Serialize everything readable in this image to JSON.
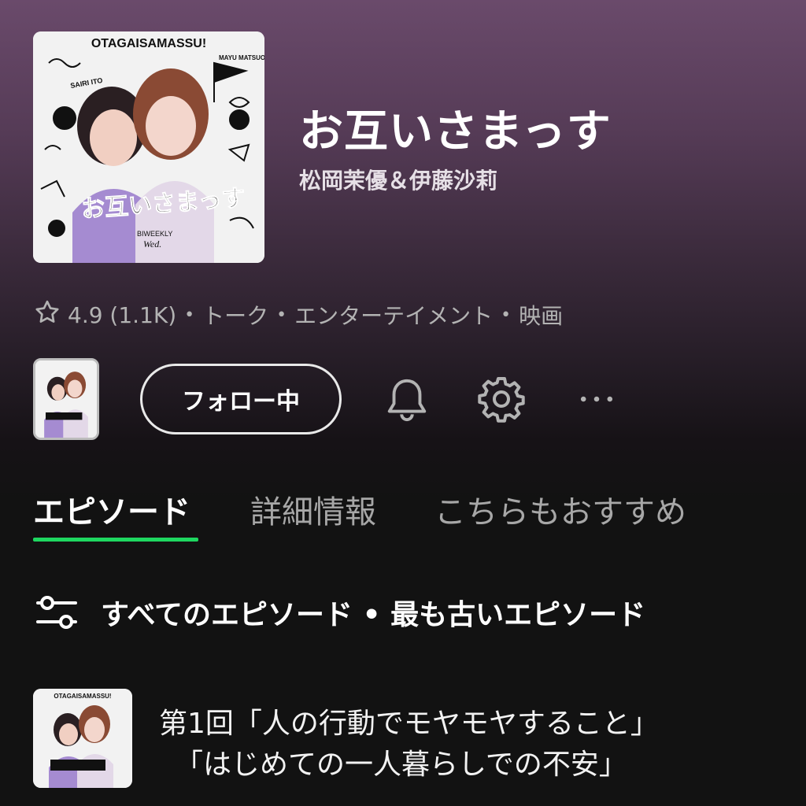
{
  "podcast": {
    "cover_text_top": "OTAGAISAMASSU!",
    "cover_text_name1": "SAIRI ITO",
    "cover_text_name2": "MAYU MATSUOKA",
    "cover_text_logo": "お互いさまっす",
    "cover_text_biweekly": "BIWEEKLY",
    "cover_text_day": "Wed.",
    "title": "お互いさまっす",
    "author": "松岡茉優＆伊藤沙莉"
  },
  "meta": {
    "rating": "4.9 (1.1K)",
    "categories": [
      "トーク",
      "エンターテイメント",
      "映画"
    ]
  },
  "actions": {
    "follow_label": "フォロー中"
  },
  "tabs": [
    {
      "label": "エピソード"
    },
    {
      "label": "詳細情報"
    },
    {
      "label": "こちらもおすすめ"
    }
  ],
  "filter": {
    "label": "すべてのエピソード • 最も古いエピソード"
  },
  "episodes": [
    {
      "title_line1": "第1回「人の行動でモヤモヤすること」",
      "title_line2": "「はじめての一人暮らしでの不安」"
    }
  ],
  "colors": {
    "accent": "#1ed760",
    "background": "#121212",
    "header_gradient_top": "#6a4a6b",
    "muted_text": "#b3b3b3"
  },
  "icons": [
    "star-icon",
    "bell-icon",
    "gear-icon",
    "more-icon",
    "filter-icon"
  ]
}
